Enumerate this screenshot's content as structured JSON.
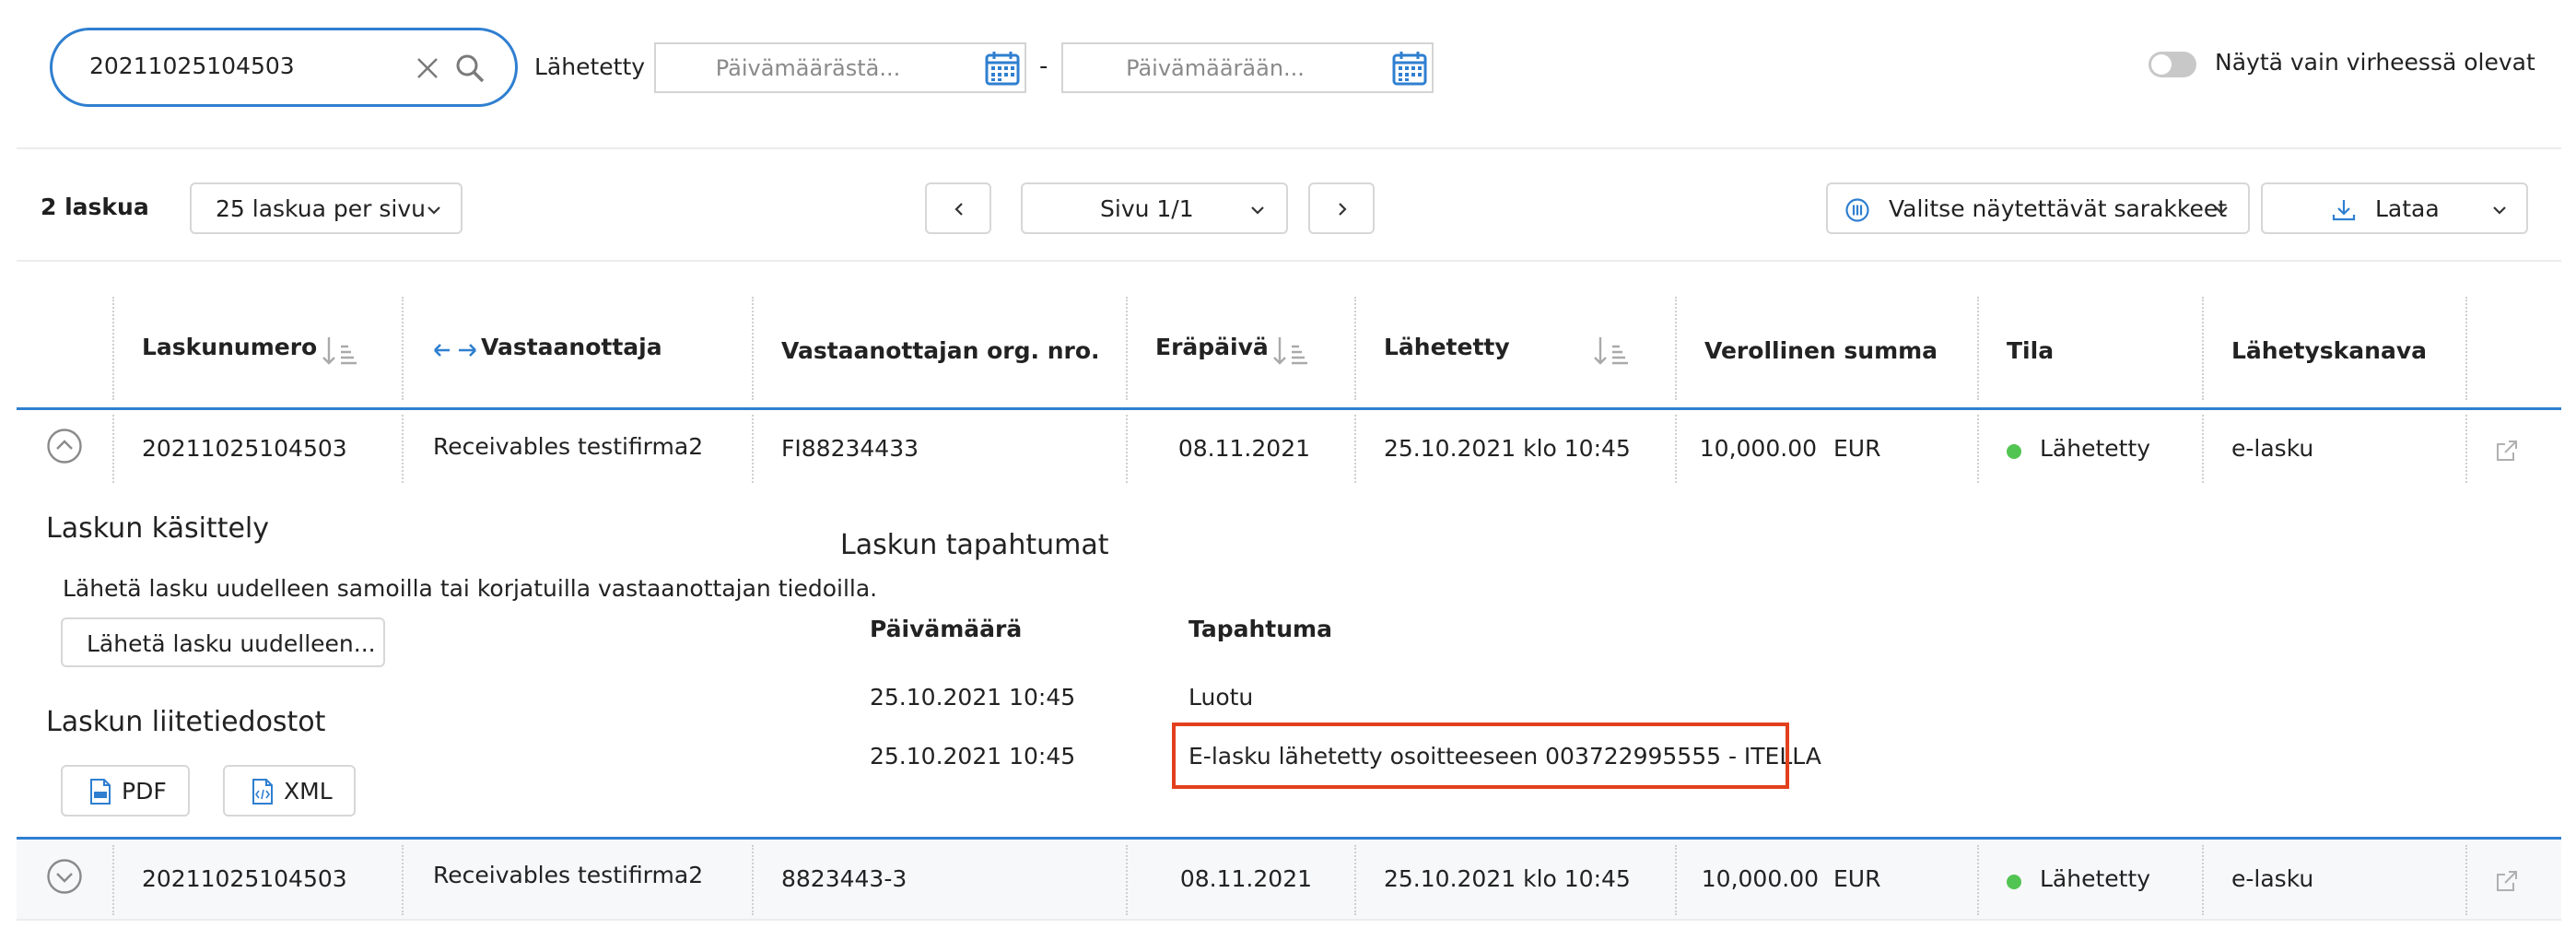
{
  "search": {
    "value": "20211025104503"
  },
  "filter": {
    "sent_label": "Lähetetty",
    "date_from_placeholder": "Päivämäärästä...",
    "date_to_placeholder": "Päivämäärään...",
    "date_separator": "-",
    "errors_only_label": "Näytä vain virheessä olevat"
  },
  "toolbar": {
    "count": "2 laskua",
    "per_page": "25 laskua per sivu",
    "page": "Sivu 1/1",
    "columns_button": "Valitse näytettävät sarakkeet",
    "download_button": "Lataa"
  },
  "table": {
    "headers": {
      "invoice_number": "Laskunumero",
      "recipient": "Vastaanottaja",
      "org_number": "Vastaanottajan org. nro.",
      "due_date": "Eräpäivä",
      "sent": "Lähetetty",
      "total": "Verollinen summa",
      "status": "Tila",
      "channel": "Lähetyskanava"
    },
    "rows": [
      {
        "invoice_number": "20211025104503",
        "recipient": "Receivables testifirma2",
        "org_number": "FI88234433",
        "due_date": "08.11.2021",
        "sent": "25.10.2021 klo 10:45",
        "amount": "10,000.00",
        "currency": "EUR",
        "status": "Lähetetty",
        "channel": "e-lasku"
      },
      {
        "invoice_number": "20211025104503",
        "recipient": "Receivables testifirma2",
        "org_number": "8823443-3",
        "due_date": "08.11.2021",
        "sent": "25.10.2021 klo 10:45",
        "amount": "10,000.00",
        "currency": "EUR",
        "status": "Lähetetty",
        "channel": "e-lasku"
      }
    ]
  },
  "details": {
    "handling_title": "Laskun käsittely",
    "handling_text": "Lähetä lasku uudelleen samoilla tai korjatuilla vastaanottajan tiedoilla.",
    "resend_button": "Lähetä lasku uudelleen...",
    "attachments_title": "Laskun liitetiedostot",
    "pdf_button": "PDF",
    "xml_button": "XML",
    "events_title": "Laskun tapahtumat",
    "events_headers": {
      "date": "Päivämäärä",
      "event": "Tapahtuma"
    },
    "events": [
      {
        "date": "25.10.2021 10:45",
        "event": "Luotu"
      },
      {
        "date": "25.10.2021 10:45",
        "event": "E-lasku lähetetty osoitteeseen 003722995555 - ITELLA"
      }
    ]
  },
  "colors": {
    "accent": "#2f7fd0",
    "status_ok": "#52c452",
    "highlight": "#e2401c"
  }
}
